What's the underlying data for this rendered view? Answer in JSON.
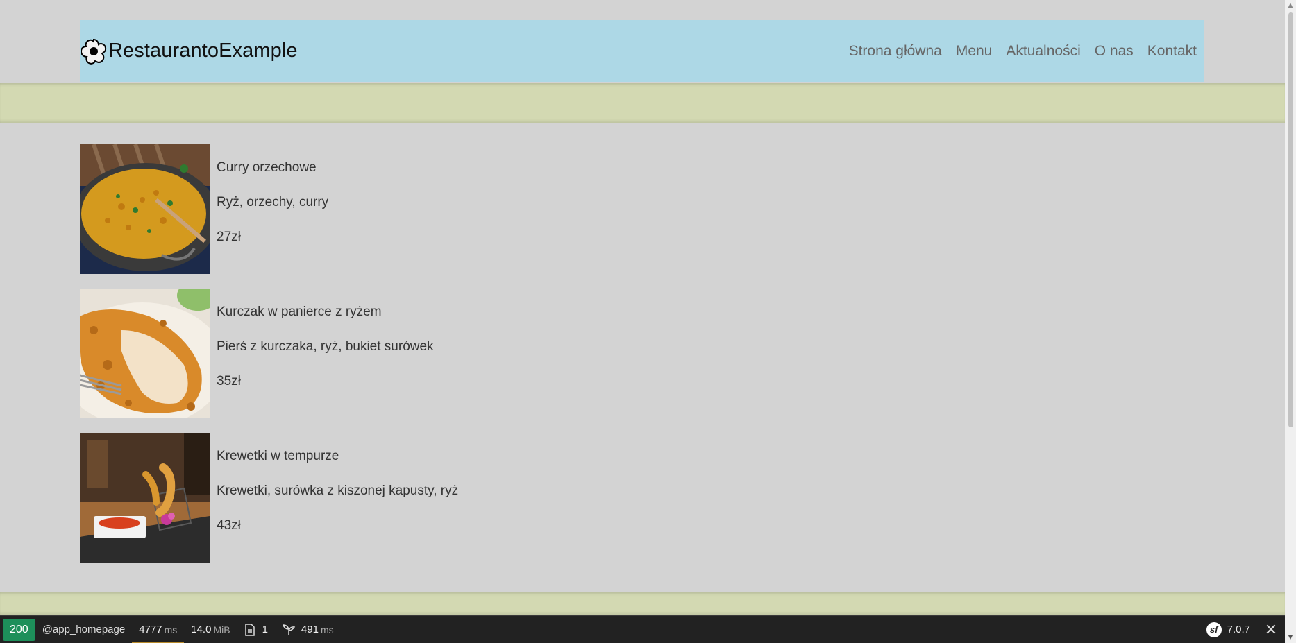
{
  "header": {
    "logo_icon": "flower-icon",
    "logo_text": "RestaurantoExample",
    "nav": [
      {
        "label": "Strona główna"
      },
      {
        "label": "Menu"
      },
      {
        "label": "Aktualności"
      },
      {
        "label": "O nas"
      },
      {
        "label": "Kontakt"
      }
    ]
  },
  "menu": [
    {
      "name": "Curry orzechowe",
      "ingredients": "Ryż, orzechy, curry",
      "price": "27zł",
      "image": "curry-dish-photo"
    },
    {
      "name": "Kurczak w panierce z ryżem",
      "ingredients": "Pierś z kurczaka, ryż, bukiet surówek",
      "price": "35zł",
      "image": "breaded-chicken-photo"
    },
    {
      "name": "Krewetki w tempurze",
      "ingredients": "Krewetki, surówka z kiszonej kapusty, ryż",
      "price": "43zł",
      "image": "tempura-shrimp-photo"
    }
  ],
  "toolbar": {
    "status_code": "200",
    "route": "@app_homepage",
    "time_value": "4777",
    "time_unit": "ms",
    "memory_value": "14.0",
    "memory_unit": "MiB",
    "file_count": "1",
    "init_value": "491",
    "init_unit": "ms",
    "version": "7.0.7",
    "colors": {
      "status": "#1d8f5a",
      "background": "#222222"
    }
  },
  "colors": {
    "page_background": "#d3d3d3",
    "header_background": "#add8e6",
    "band": "#d3d9b2"
  }
}
